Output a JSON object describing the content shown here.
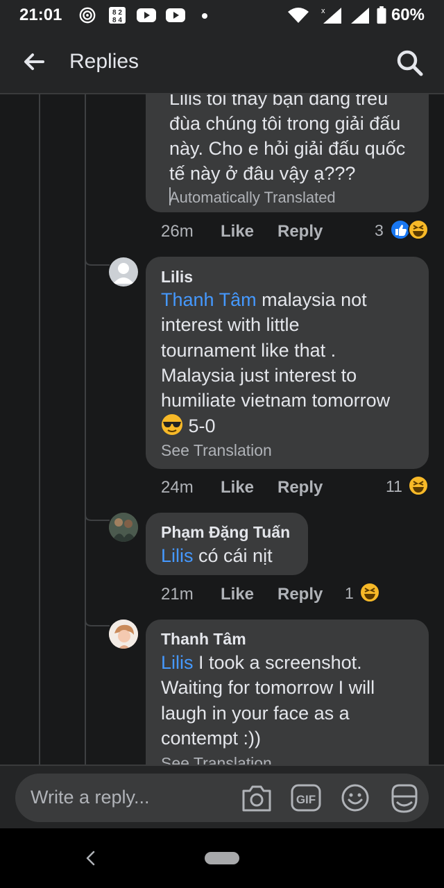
{
  "status_bar": {
    "time": "21:01",
    "battery": "60%",
    "icons": [
      "hotspot-icon",
      "app-icon",
      "youtube-icon",
      "youtube-icon",
      "dot-icon",
      "wifi-icon",
      "signal-icon",
      "signal-icon",
      "battery-icon"
    ]
  },
  "header": {
    "title": "Replies",
    "back_icon": "arrow-left-icon",
    "search_icon": "search-icon"
  },
  "comments": [
    {
      "text_lines": [
        "Lilis tôi thấy bạn đang trêu",
        "đùa chúng tôi trong giải đấu",
        "này. Cho e hỏi giải đấu quốc",
        "tế này ở đâu vậy ạ???"
      ],
      "note": "Automatically Translated",
      "time": "26m",
      "like": "Like",
      "reply": "Reply",
      "reactions_count": "3"
    },
    {
      "author": "Lilis",
      "mention": "Thanh Tâm",
      "text_line1": " malaysia not",
      "text_lines": [
        "interest with little",
        "tournament  like that  .",
        "Malaysia just interest to",
        "humiliate vietnam tomorrow"
      ],
      "text_last": " 5-0",
      "note": "See Translation",
      "time": "24m",
      "like": "Like",
      "reply": "Reply",
      "reactions_count": "11"
    },
    {
      "author": "Phạm Đặng Tuấn",
      "mention": "Lilis",
      "text": " có cái nịt",
      "time": "21m",
      "like": "Like",
      "reply": "Reply",
      "reactions_count": "1"
    },
    {
      "author": "Thanh Tâm",
      "mention": "Lilis",
      "text_line1": " I took a screenshot.",
      "text_lines": [
        "Waiting for tomorrow I will",
        "laugh in your face as a",
        "contempt :))"
      ],
      "note": "See Translation"
    }
  ],
  "composer": {
    "placeholder": "Write a reply...",
    "icons": [
      "camera-icon",
      "gif-icon",
      "emoji-icon",
      "sticker-icon"
    ]
  },
  "nav": {
    "back_icon": "chevron-left-icon",
    "home_icon": "home-pill-icon"
  },
  "colors": {
    "background": "#18191a",
    "bar": "#242526",
    "bubble": "#3a3b3c",
    "mention": "#4599ff",
    "like_blue": "#1877f2",
    "haha_yellow": "#f7b928"
  }
}
